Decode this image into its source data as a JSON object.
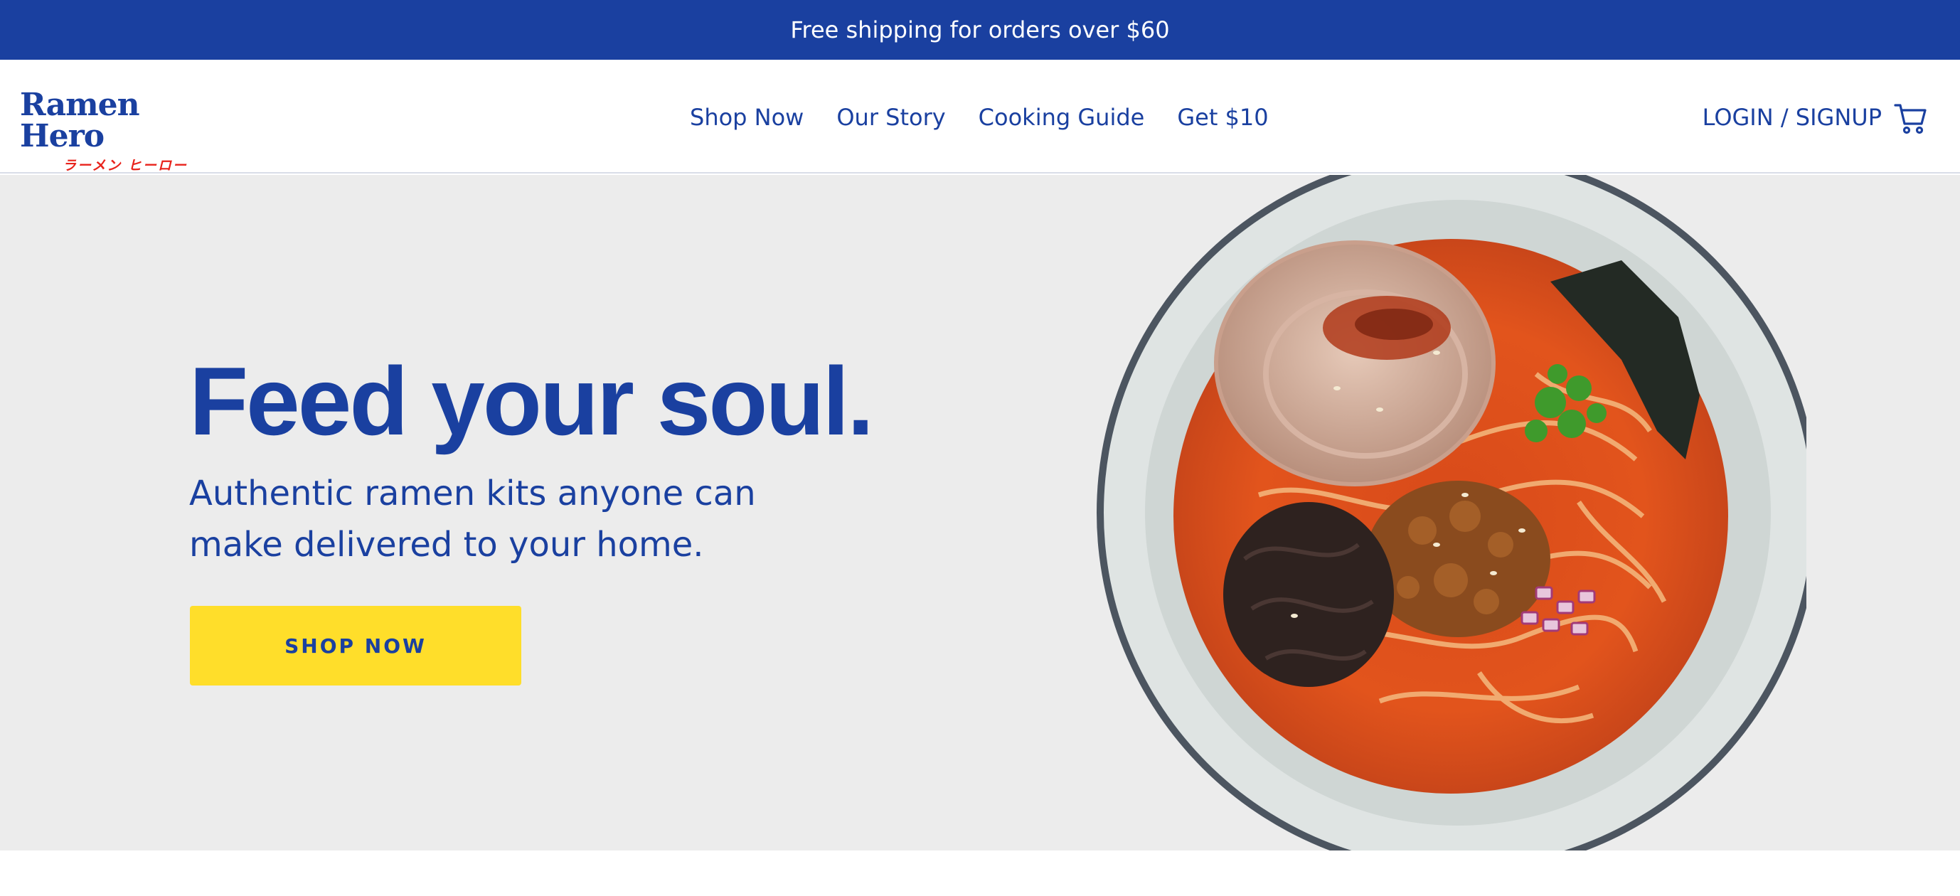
{
  "announcement": {
    "text": "Free shipping for orders over $60"
  },
  "header": {
    "logo": {
      "name": "Ramen Hero",
      "subtitle": "ラーメン ヒーロー"
    },
    "nav": [
      {
        "label": "Shop Now"
      },
      {
        "label": "Our Story"
      },
      {
        "label": "Cooking Guide"
      },
      {
        "label": "Get $10"
      }
    ],
    "login_label": "LOGIN / SIGNUP",
    "cart_icon": "cart-icon"
  },
  "hero": {
    "headline": "Feed your soul.",
    "subheadline": "Authentic ramen kits anyone can make delivered to your home.",
    "cta_label": "SHOP NOW",
    "image": "ramen-bowl-image"
  },
  "colors": {
    "brand_blue": "#1a40a0",
    "cta_yellow": "#ffde2a",
    "logo_red": "#e8231c",
    "hero_bg": "#ececec"
  }
}
